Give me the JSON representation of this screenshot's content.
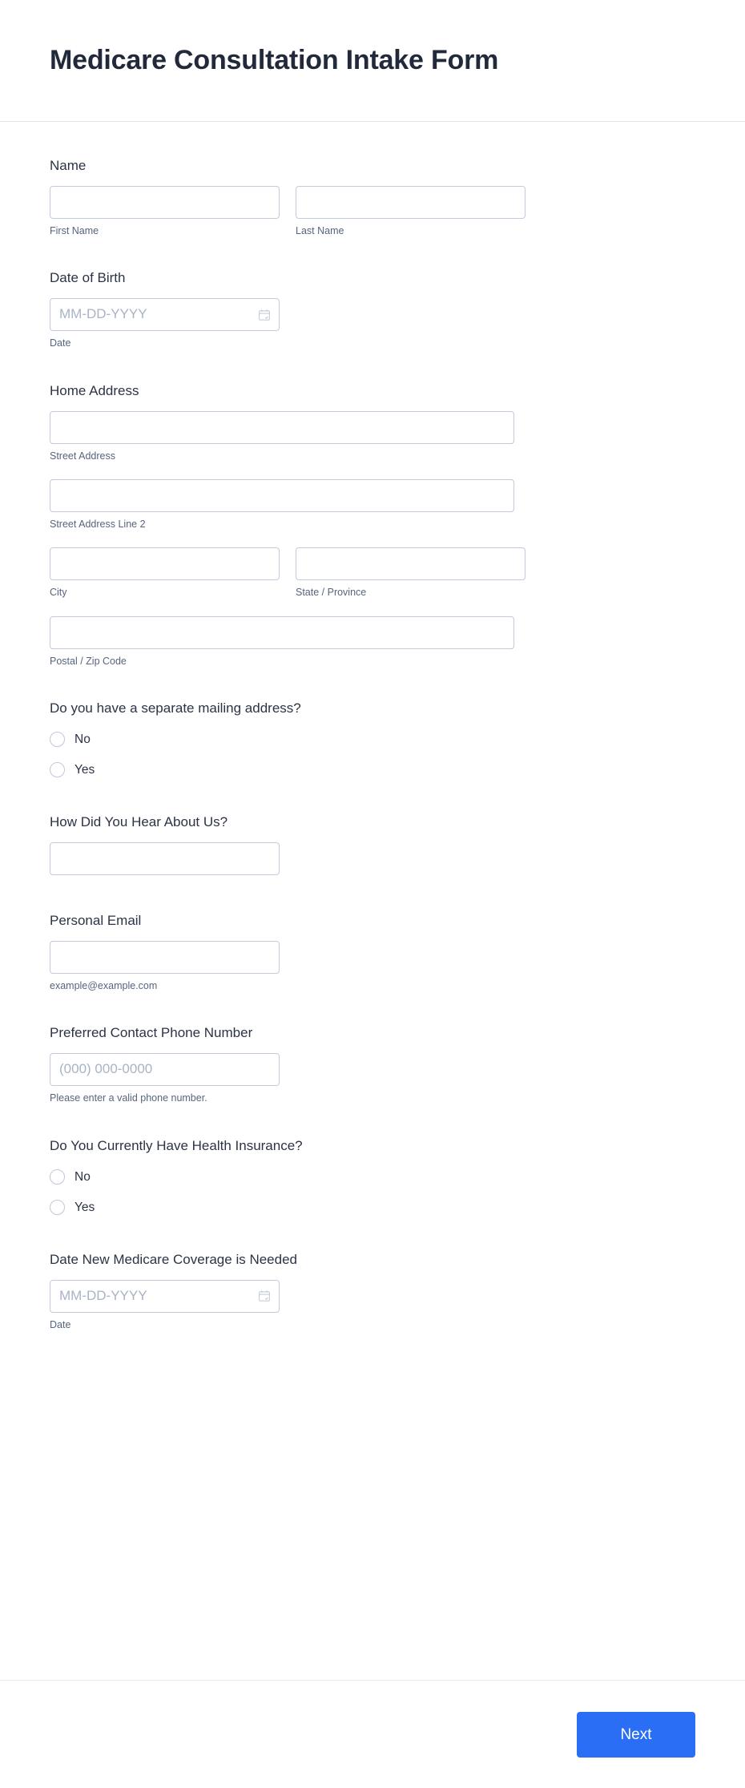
{
  "header": {
    "title": "Medicare Consultation Intake Form"
  },
  "fields": {
    "name": {
      "label": "Name",
      "first": {
        "sub_label": "First Name",
        "value": "",
        "placeholder": ""
      },
      "last": {
        "sub_label": "Last Name",
        "value": "",
        "placeholder": ""
      }
    },
    "date_of_birth": {
      "label": "Date of Birth",
      "placeholder": "MM-DD-YYYY",
      "value": "",
      "sub_label": "Date",
      "icon": "calendar-icon"
    },
    "home_address": {
      "label": "Home Address",
      "street": {
        "sub_label": "Street Address",
        "value": ""
      },
      "street2": {
        "sub_label": "Street Address Line 2",
        "value": ""
      },
      "city": {
        "sub_label": "City",
        "value": ""
      },
      "state": {
        "sub_label": "State / Province",
        "value": ""
      },
      "postal": {
        "sub_label": "Postal / Zip Code",
        "value": ""
      }
    },
    "separate_mailing": {
      "label": "Do you have a separate mailing address?",
      "options": [
        {
          "label": "No",
          "selected": false
        },
        {
          "label": "Yes",
          "selected": false
        }
      ]
    },
    "hear_about_us": {
      "label": "How Did You Hear About Us?",
      "value": "",
      "placeholder": ""
    },
    "personal_email": {
      "label": "Personal Email",
      "value": "",
      "placeholder": "",
      "sub_label": "example@example.com"
    },
    "phone": {
      "label": "Preferred Contact Phone Number",
      "placeholder": "(000) 000-0000",
      "value": "",
      "sub_label": "Please enter a valid phone number."
    },
    "has_insurance": {
      "label": "Do You Currently Have Health Insurance?",
      "options": [
        {
          "label": "No",
          "selected": false
        },
        {
          "label": "Yes",
          "selected": false
        }
      ]
    },
    "coverage_date": {
      "label": "Date New Medicare Coverage is Needed",
      "placeholder": "MM-DD-YYYY",
      "value": "",
      "sub_label": "Date",
      "icon": "calendar-icon"
    }
  },
  "footer": {
    "next_label": "Next",
    "next_color": "#2b6ef6"
  }
}
